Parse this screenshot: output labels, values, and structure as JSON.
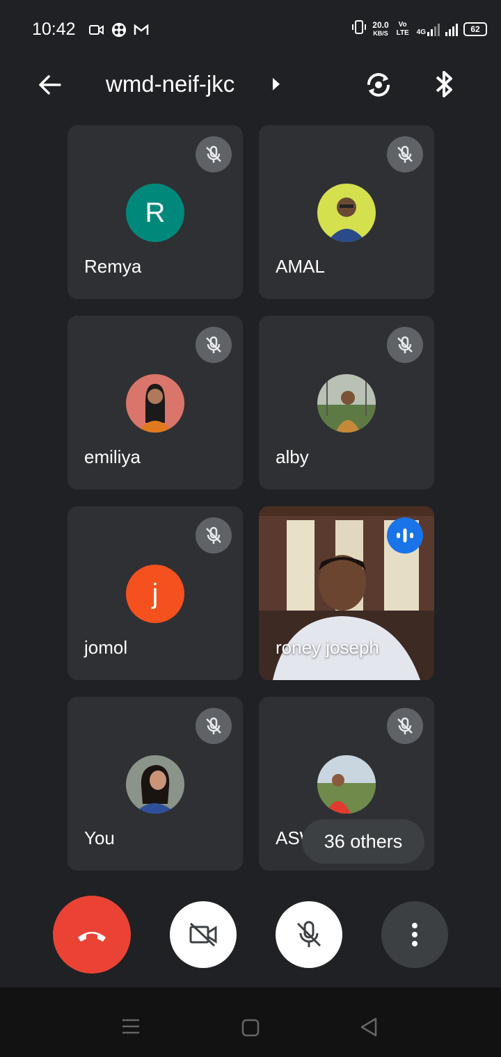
{
  "status_bar": {
    "time": "10:42",
    "net_speed": "20.0",
    "net_unit": "KB/S",
    "volte": "Vo LTE",
    "network": "4G",
    "battery": "62"
  },
  "header": {
    "meeting_code": "wmd-neif-jkc"
  },
  "participants": [
    {
      "name": "Remya",
      "initial": "R",
      "avatar_color": "#00897b",
      "muted": true
    },
    {
      "name": "AMAL",
      "initial": "",
      "avatar_color": "#c9d84a",
      "muted": true
    },
    {
      "name": "emiliya",
      "initial": "",
      "avatar_color": "#d9756a",
      "muted": true
    },
    {
      "name": "alby",
      "initial": "",
      "avatar_color": "#8a9a7a",
      "muted": true
    },
    {
      "name": "jomol",
      "initial": "j",
      "avatar_color": "#f4511e",
      "muted": true
    },
    {
      "name": "roney joseph",
      "initial": "",
      "avatar_color": "#7a5b47",
      "muted": false,
      "speaking": true
    },
    {
      "name": "You",
      "initial": "",
      "avatar_color": "#4a6fa0",
      "muted": true
    },
    {
      "name": "ASW",
      "initial": "",
      "avatar_color": "#d24a3a",
      "muted": true
    }
  ],
  "others_label": "36 others",
  "colors": {
    "background": "#202124",
    "tile": "#2f3034",
    "end_call": "#ea4335",
    "speaking": "#1a73e8"
  }
}
